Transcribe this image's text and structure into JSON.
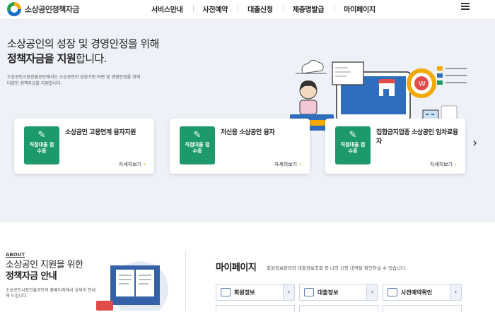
{
  "header": {
    "logo_text": "소상공인정책자금",
    "nav": [
      "서비스안내",
      "사전예약",
      "대출신청",
      "제증명발급",
      "마이페이지"
    ]
  },
  "hero": {
    "title_line1": "소상공인의 성장 및 경영안정을 위해",
    "title_strong": "정책자금을 지원",
    "title_rest": "합니다.",
    "desc": "소상공인시장진흥공단에서는 소상공인의 성장기반 마련 및 경영안정을 위해 다양한 정책자금을 지원합니다."
  },
  "cards": [
    {
      "badge": "직접대출 접수중",
      "title": "소상공인 고용연계 융자지원",
      "more": "자세히보기"
    },
    {
      "badge": "직접대출 접수중",
      "title": "저신용 소상공인 융자",
      "more": "자세히보기"
    },
    {
      "badge": "직접대출 접수중",
      "title": "집합금지업종 소상공인 임차료융자",
      "more": "자세히보기"
    }
  ],
  "about": {
    "kicker": "ABOUT",
    "title_line1": "소상공인 지원을 위한",
    "title_strong": "정책자금 안내",
    "desc": "소상공인시장진흥공단의 홈페이지에서 상세히 안내해 드립니다."
  },
  "mypage": {
    "title": "마이페이지",
    "desc": "회원정보관리와 대출정보조회 등 나의 신청 내역을 확인하실 수 있습니다.",
    "buttons": [
      "회원정보",
      "대출정보",
      "사전예약확인"
    ]
  },
  "colors": {
    "accent_green": "#1d9a6c",
    "hero_bg": "#eef1f7",
    "more_arrow": "#e08a00"
  }
}
